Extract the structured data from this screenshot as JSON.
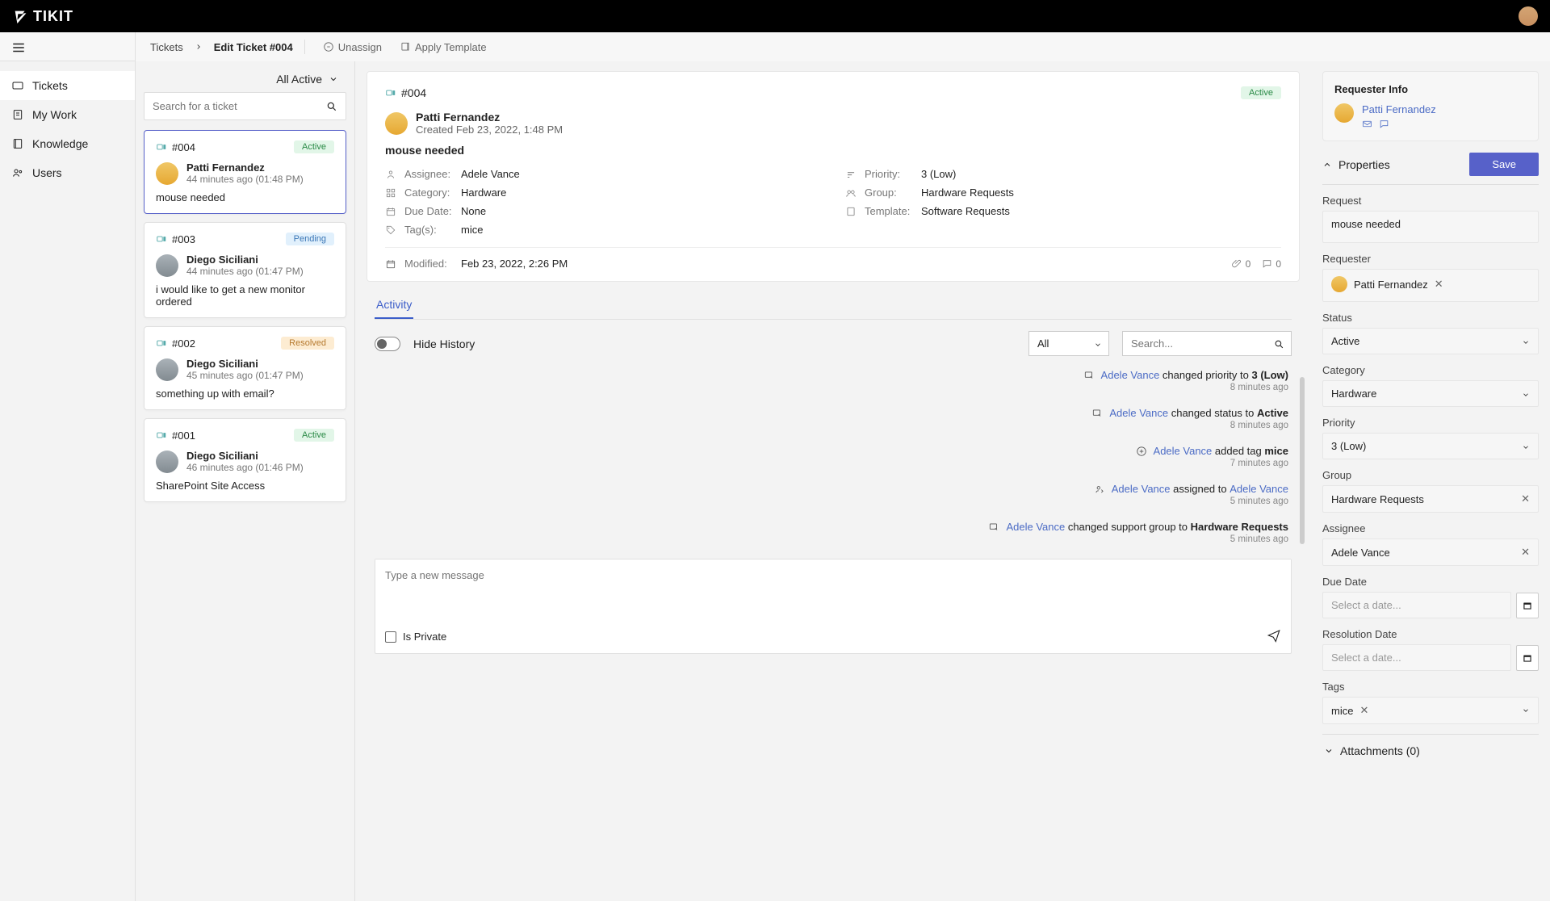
{
  "brand": "TIKIT",
  "nav": {
    "items": [
      {
        "label": "Tickets",
        "icon": "i-ticket"
      },
      {
        "label": "My Work",
        "icon": "i-work"
      },
      {
        "label": "Knowledge",
        "icon": "i-book"
      },
      {
        "label": "Users",
        "icon": "i-users"
      }
    ]
  },
  "breadcrumb": {
    "root": "Tickets",
    "current": "Edit Ticket #004",
    "actions": [
      {
        "label": "Unassign",
        "icon": "i-unassign"
      },
      {
        "label": "Apply Template",
        "icon": "i-template"
      }
    ]
  },
  "filter": {
    "label": "All Active"
  },
  "search": {
    "placeholder": "Search for a ticket"
  },
  "tickets": [
    {
      "id": "#004",
      "status": "Active",
      "status_class": "active",
      "user": "Patti Fernandez",
      "time": "44 minutes ago (01:48 PM)",
      "title": "mouse needed",
      "avatar": "patti",
      "selected": true
    },
    {
      "id": "#003",
      "status": "Pending",
      "status_class": "pending",
      "user": "Diego Siciliani",
      "time": "44 minutes ago (01:47 PM)",
      "title": "i would like to get a new monitor ordered",
      "avatar": "diego"
    },
    {
      "id": "#002",
      "status": "Resolved",
      "status_class": "resolved",
      "user": "Diego Siciliani",
      "time": "45 minutes ago (01:47 PM)",
      "title": "something up with email?",
      "avatar": "diego"
    },
    {
      "id": "#001",
      "status": "Active",
      "status_class": "active",
      "user": "Diego Siciliani",
      "time": "46 minutes ago (01:46 PM)",
      "title": "SharePoint Site Access",
      "avatar": "diego"
    }
  ],
  "detail": {
    "id": "#004",
    "status": "Active",
    "user": "Patti Fernandez",
    "created": "Created Feb 23, 2022, 1:48 PM",
    "title": "mouse needed",
    "meta": {
      "assignee_label": "Assignee:",
      "assignee": "Adele Vance",
      "priority_label": "Priority:",
      "priority": "3 (Low)",
      "category_label": "Category:",
      "category": "Hardware",
      "group_label": "Group:",
      "group": "Hardware Requests",
      "duedate_label": "Due Date:",
      "duedate": "None",
      "template_label": "Template:",
      "template": "Software Requests",
      "tags_label": "Tag(s):",
      "tags": "mice"
    },
    "modified_label": "Modified:",
    "modified": "Feb 23, 2022, 2:26 PM",
    "attach_count": "0",
    "comment_count": "0"
  },
  "activity": {
    "tab": "Activity",
    "hide_history": "Hide History",
    "filter": "All",
    "search_placeholder": "Search...",
    "items": [
      {
        "icon": "i-edit",
        "user": "Adele Vance",
        "text_a": " changed priority to ",
        "bold": "3 (Low)",
        "time": "8 minutes ago"
      },
      {
        "icon": "i-edit",
        "user": "Adele Vance",
        "text_a": " changed status to ",
        "bold": "Active",
        "time": "8 minutes ago"
      },
      {
        "icon": "i-plus",
        "user": "Adele Vance",
        "text_a": " added tag ",
        "bold": "mice",
        "time": "7 minutes ago"
      },
      {
        "icon": "i-assign",
        "user": "Adele Vance",
        "text_a": " assigned to ",
        "user2": "Adele Vance",
        "time": "5 minutes ago"
      },
      {
        "icon": "i-edit",
        "user": "Adele Vance",
        "text_a": " changed support group to ",
        "bold": "Hardware Requests",
        "time": "5 minutes ago"
      }
    ]
  },
  "compose": {
    "placeholder": "Type a new message",
    "private": "Is Private"
  },
  "requester": {
    "title": "Requester Info",
    "name": "Patti Fernandez"
  },
  "props": {
    "title": "Properties",
    "save": "Save",
    "request_label": "Request",
    "request": "mouse needed",
    "requester_label": "Requester",
    "requester": "Patti Fernandez",
    "status_label": "Status",
    "status": "Active",
    "category_label": "Category",
    "category": "Hardware",
    "priority_label": "Priority",
    "priority": "3 (Low)",
    "group_label": "Group",
    "group": "Hardware Requests",
    "assignee_label": "Assignee",
    "assignee": "Adele Vance",
    "duedate_label": "Due Date",
    "duedate_placeholder": "Select a date...",
    "resdate_label": "Resolution Date",
    "resdate_placeholder": "Select a date...",
    "tags_label": "Tags",
    "tag": "mice"
  },
  "attachments": {
    "title": "Attachments (0)"
  }
}
